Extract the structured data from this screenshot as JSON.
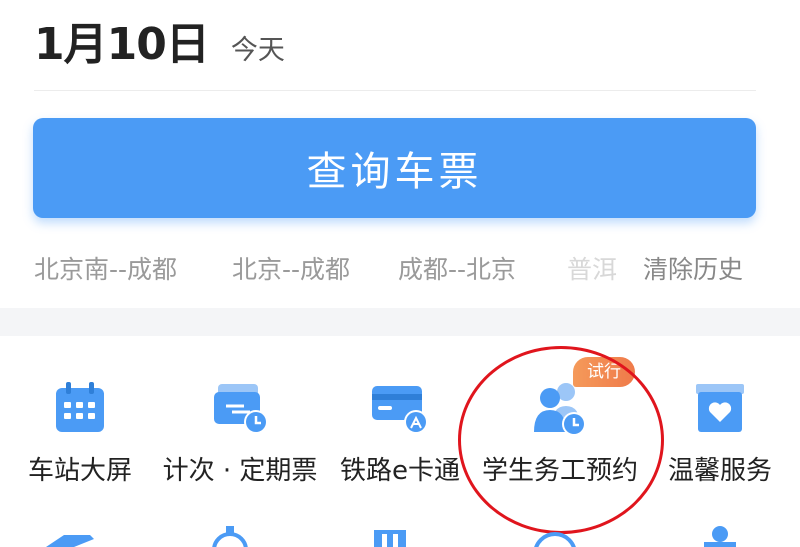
{
  "date": {
    "main": "1月10日",
    "sub": "今天"
  },
  "query_button": {
    "label": "查询车票"
  },
  "history": {
    "items": [
      "北京南--成都",
      "北京--成都",
      "成都--北京"
    ],
    "faded": "普洱",
    "clear_label": "清除历史"
  },
  "services": {
    "tiles": [
      {
        "label": "车站大屏",
        "icon": "calendar-grid-icon"
      },
      {
        "label": "计次 · 定期票",
        "icon": "ticket-clock-icon"
      },
      {
        "label": "铁路e卡通",
        "icon": "card-train-icon"
      },
      {
        "label": "学生务工预约",
        "icon": "people-clock-icon"
      },
      {
        "label": "温馨服务",
        "icon": "heart-box-icon"
      }
    ],
    "badge": "试行"
  },
  "colors": {
    "accent": "#4b9bf5",
    "highlight_circle": "#e0151d",
    "badge": "#ef7a4a"
  }
}
